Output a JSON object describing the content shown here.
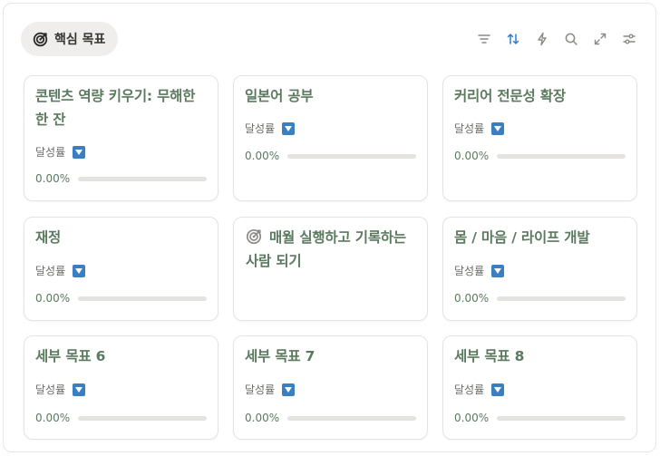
{
  "view_tab": {
    "label": "핵심 목표",
    "icon": "target-icon"
  },
  "toolbar": [
    "filter-icon",
    "sort-icon",
    "automation-lightning-icon",
    "search-icon",
    "expand-icon",
    "settings-sliders-icon"
  ],
  "colors": {
    "title": "#5b7a5f",
    "dropdown": "#3a7fc1",
    "bar_track": "#e4e3e0"
  },
  "cards": [
    {
      "title": "콘텐츠 역량 키우기: 무해한 한 잔",
      "prop_label": "달성률",
      "progress_text": "0.00%",
      "progress": 0
    },
    {
      "title": "일본어 공부",
      "prop_label": "달성률",
      "progress_text": "0.00%",
      "progress": 0
    },
    {
      "title": "커리어 전문성 확장",
      "prop_label": "달성률",
      "progress_text": "0.00%",
      "progress": 0
    },
    {
      "title": "재정",
      "prop_label": "달성률",
      "progress_text": "0.00%",
      "progress": 0
    },
    {
      "title": "매월 실행하고 기록하는 사람 되기",
      "icon": "target-icon"
    },
    {
      "title": "몸 / 마음 / 라이프 개발",
      "prop_label": "달성률",
      "progress_text": "0.00%",
      "progress": 0
    },
    {
      "title": "세부 목표 6",
      "prop_label": "달성률",
      "progress_text": "0.00%",
      "progress": 0
    },
    {
      "title": "세부 목표 7",
      "prop_label": "달성률",
      "progress_text": "0.00%",
      "progress": 0
    },
    {
      "title": "세부 목표 8",
      "prop_label": "달성률",
      "progress_text": "0.00%",
      "progress": 0
    }
  ]
}
